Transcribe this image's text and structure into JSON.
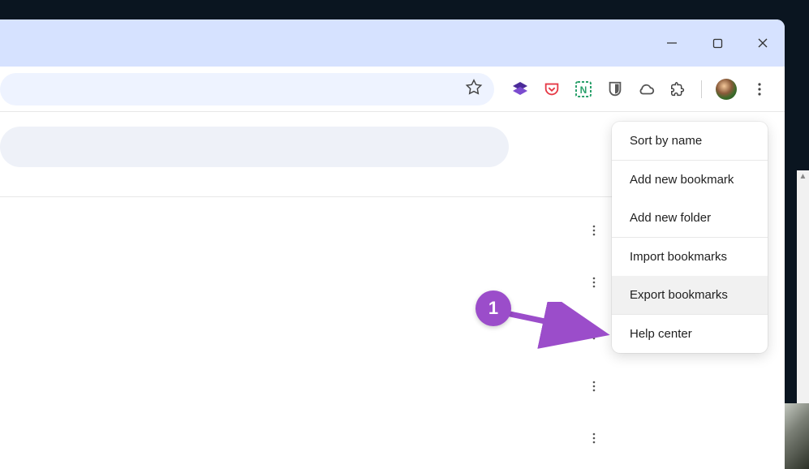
{
  "window_controls": {
    "minimize": "minimize",
    "maximize": "maximize",
    "close": "close"
  },
  "toolbar": {
    "star": "bookmark-star",
    "extensions": [
      {
        "name": "layers-purple-icon"
      },
      {
        "name": "pocket-icon"
      },
      {
        "name": "notion-clipper-icon"
      },
      {
        "name": "bitwarden-icon"
      },
      {
        "name": "cloud-icon"
      },
      {
        "name": "extensions-puzzle-icon"
      }
    ],
    "profile": "user-avatar",
    "menu": "chrome-menu"
  },
  "context_menu": {
    "items": [
      {
        "label": "Sort by name",
        "id": "sort-by-name"
      },
      {
        "label": "Add new bookmark",
        "id": "add-new-bookmark"
      },
      {
        "label": "Add new folder",
        "id": "add-new-folder"
      },
      {
        "label": "Import bookmarks",
        "id": "import-bookmarks"
      },
      {
        "label": "Export bookmarks",
        "id": "export-bookmarks",
        "hovered": true
      },
      {
        "label": "Help center",
        "id": "help-center"
      }
    ]
  },
  "annotation": {
    "badge": "1",
    "color": "#9b4dca"
  }
}
